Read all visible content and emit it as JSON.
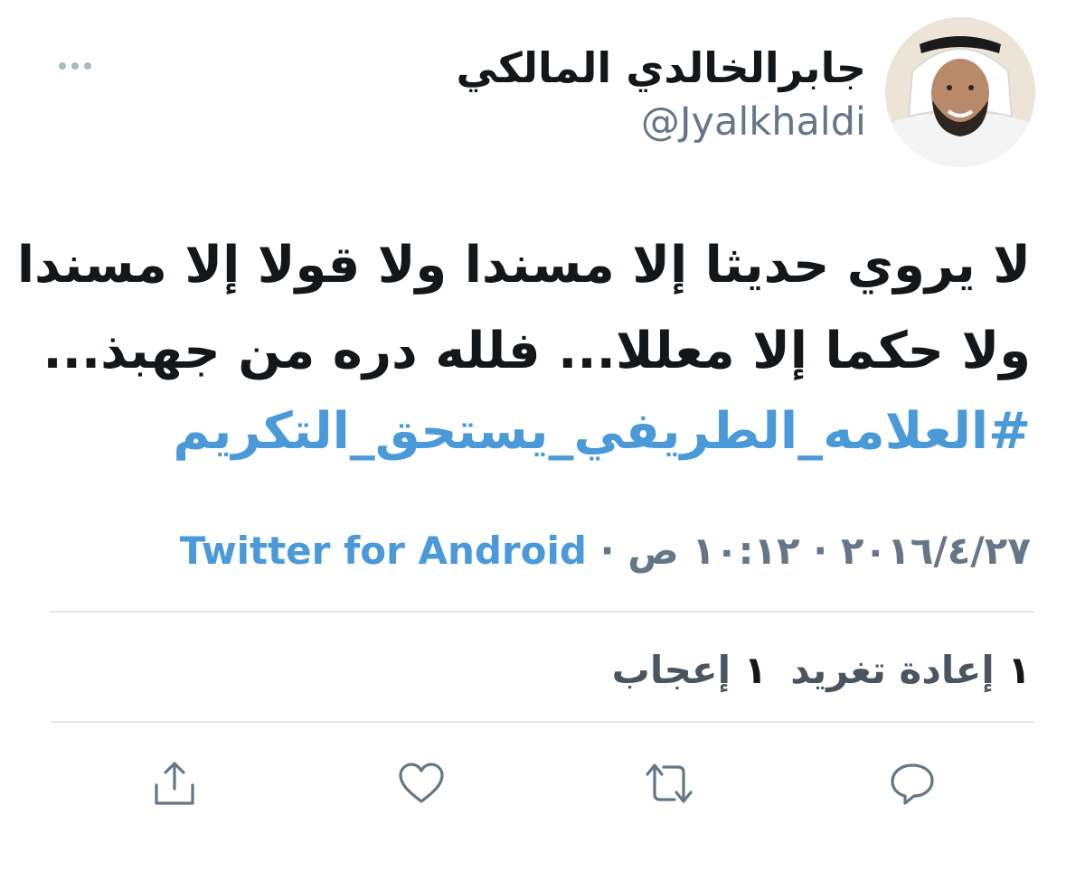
{
  "colors": {
    "accent": "#4a9ad9",
    "secondary_text": "#657786",
    "primary_text": "#14171a",
    "divider": "#e1e8ed"
  },
  "author": {
    "display_name": "جابرالخالدي المالكي",
    "handle": "@Jyalkhaldi",
    "avatar_icon": "profile-photo"
  },
  "tweet": {
    "lines": [
      "لا يروي حديثا إلا مسندا ولا قولا إلا مسندا",
      "ولا حكما إلا معللا... فلله دره من جهبذ..."
    ],
    "hashtag": "#العلامه_الطريفي_يستحق_التكريم"
  },
  "meta": {
    "date": "٢٠١٦/٤/٢٧",
    "separator": "·",
    "time": "١٠:١٢ ص",
    "source": "Twitter for Android"
  },
  "stats": {
    "retweets_count": "١",
    "retweets_label": "إعادة تغريد",
    "likes_count": "١",
    "likes_label": "إعجاب"
  },
  "actions": [
    {
      "icon": "reply-icon"
    },
    {
      "icon": "retweet-icon"
    },
    {
      "icon": "like-icon"
    },
    {
      "icon": "share-icon"
    }
  ]
}
